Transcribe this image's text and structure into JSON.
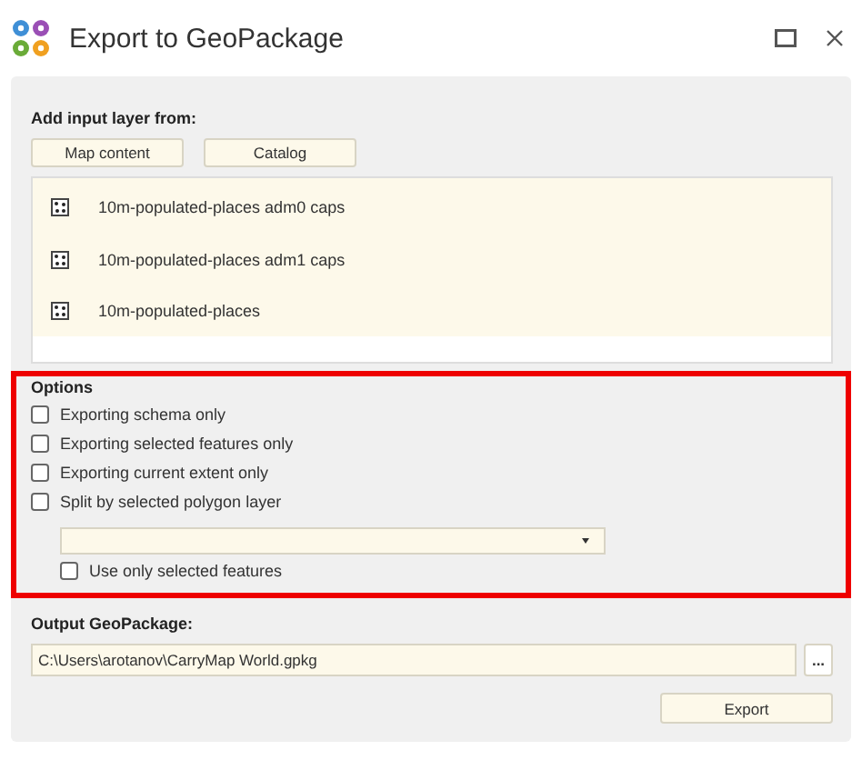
{
  "window": {
    "title": "Export to GeoPackage"
  },
  "input": {
    "heading": "Add input layer from:",
    "buttons": [
      "Map content",
      "Catalog"
    ],
    "layers": [
      {
        "name": "10m-populated-places adm0 caps"
      },
      {
        "name": "10m-populated-places adm1 caps"
      },
      {
        "name": "10m-populated-places"
      }
    ]
  },
  "options": {
    "heading": "Options",
    "items": [
      {
        "label": "Exporting schema only",
        "checked": false
      },
      {
        "label": "Exporting selected features only",
        "checked": false
      },
      {
        "label": "Exporting current extent only",
        "checked": false
      },
      {
        "label": "Split by selected polygon layer",
        "checked": false
      }
    ],
    "sub_option": {
      "label": "Use only selected features",
      "checked": false
    }
  },
  "output": {
    "heading": "Output GeoPackage:",
    "path": "C:\\Users\\arotanov\\CarryMap World.gpkg",
    "browse": "...",
    "export": "Export"
  }
}
